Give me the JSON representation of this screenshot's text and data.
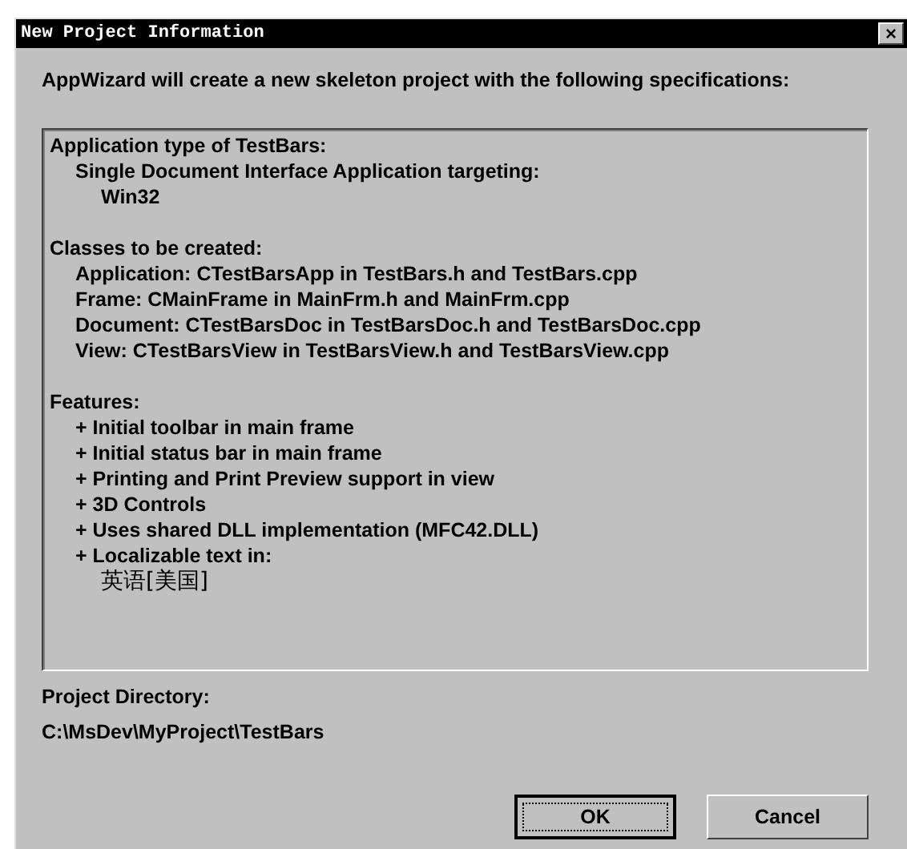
{
  "window": {
    "title": "New Project Information",
    "close": "×"
  },
  "intro": "AppWizard will create a new skeleton project with the following specifications:",
  "specifications": [
    {
      "heading": "Application type of TestBars:",
      "items": [
        {
          "text": "Single Document Interface Application targeting:",
          "children": [
            {
              "text": "Win32"
            }
          ]
        }
      ]
    },
    {
      "heading": "Classes to be created:",
      "items": [
        {
          "text": "Application: CTestBarsApp in TestBars.h and TestBars.cpp"
        },
        {
          "text": "Frame: CMainFrame in MainFrm.h and MainFrm.cpp"
        },
        {
          "text": "Document: CTestBarsDoc in TestBarsDoc.h and TestBarsDoc.cpp"
        },
        {
          "text": "View: CTestBarsView in TestBarsView.h and TestBarsView.cpp"
        }
      ]
    },
    {
      "heading": "Features:",
      "items": [
        {
          "text": "+ Initial toolbar in main frame"
        },
        {
          "text": "+ Initial status bar in main frame"
        },
        {
          "text": "+ Printing and Print Preview support in view"
        },
        {
          "text": "+ 3D Controls"
        },
        {
          "text": "+ Uses shared DLL implementation (MFC42.DLL)"
        },
        {
          "text": "+ Localizable text in:",
          "children": [
            {
              "text": "英语[美国]"
            }
          ]
        }
      ]
    }
  ],
  "project_directory": {
    "label": "Project Directory:",
    "value": "C:\\MsDev\\MyProject\\TestBars"
  },
  "buttons": [
    {
      "label": "OK",
      "default": true
    },
    {
      "label": "Cancel",
      "default": false
    }
  ]
}
